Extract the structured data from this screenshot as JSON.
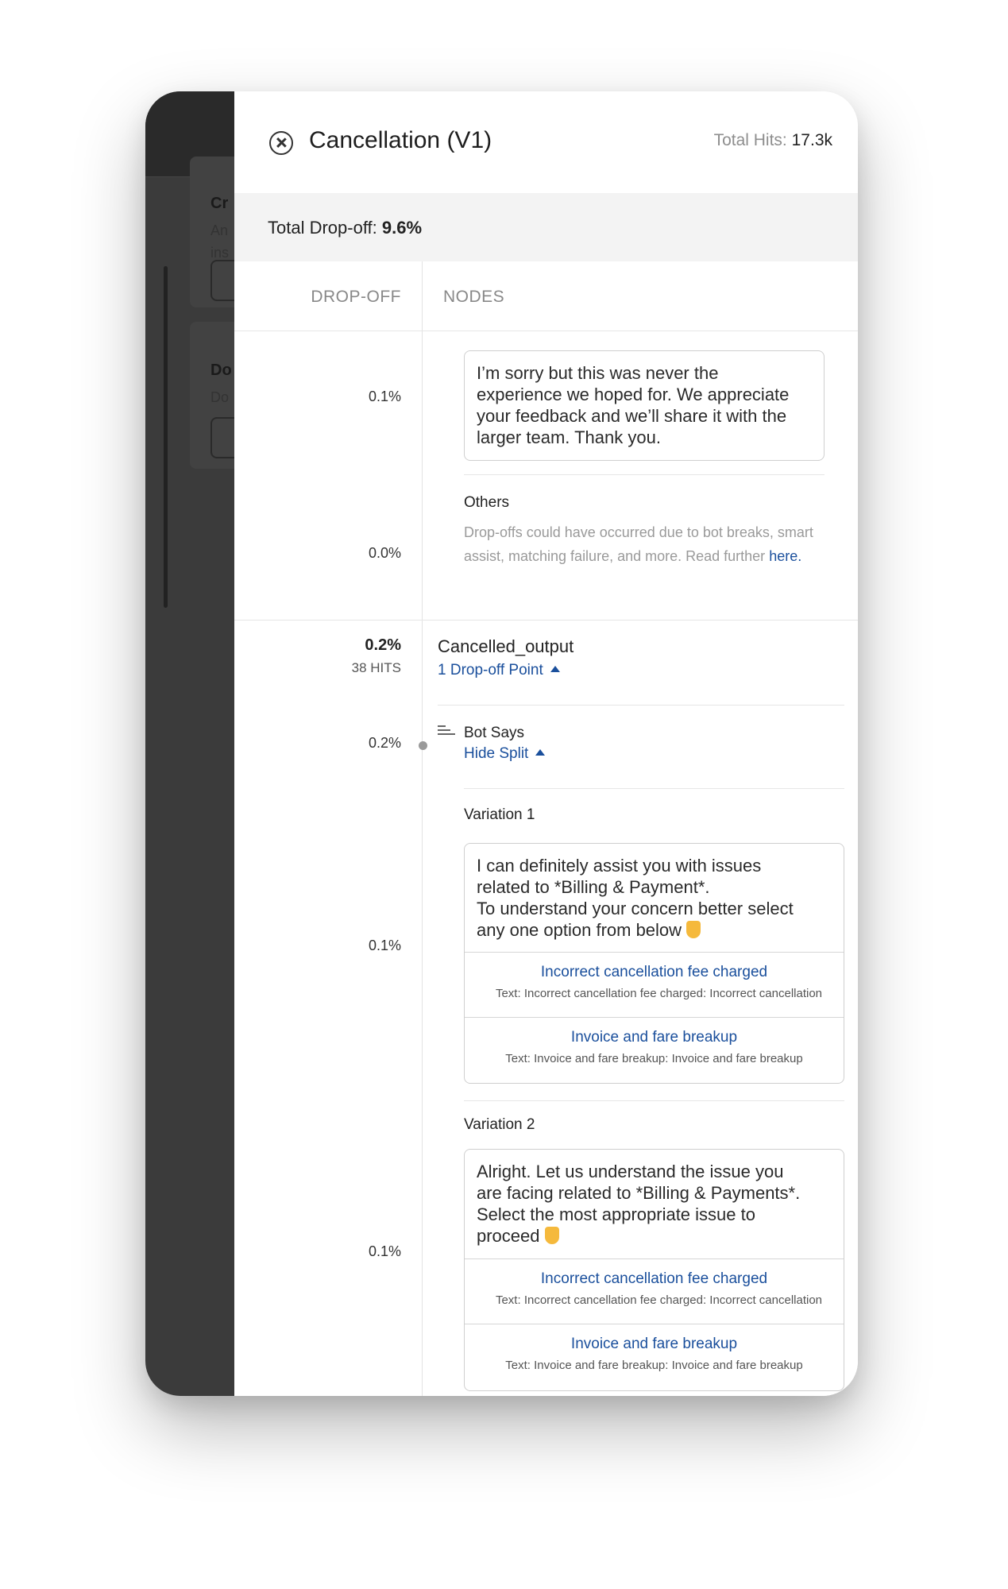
{
  "background_app": {
    "cards": [
      {
        "title": "Cr",
        "sub": [
          "An",
          "ins"
        ]
      },
      {
        "title": "Do",
        "sub": [
          "Do"
        ]
      }
    ]
  },
  "panel": {
    "title": "Cancellation (V1)",
    "total_hits_label": "Total Hits:",
    "total_hits_value": "17.3k",
    "total_dropoff_label": "Total Drop-off:",
    "total_dropoff_value": "9.6%",
    "columns": {
      "dropoff": "DROP-OFF",
      "nodes": "NODES"
    }
  },
  "section1": {
    "pct_message": "0.1%",
    "message": "I’m sorry but this was never the\nexperience we hoped for. We appreciate\nyour feedback and we’ll share it with the\nlarger team. Thank you.",
    "pct_others": "0.0%",
    "others_title": "Others",
    "others_text": "Drop-offs could have occurred due to bot breaks, smart assist, matching failure, and more. Read further",
    "others_link": "here."
  },
  "section2": {
    "pct": "0.2%",
    "hits": "38 HITS",
    "node_name": "Cancelled_output",
    "dropoff_points_link": "1 Drop-off Point",
    "bot_pct": "0.2%",
    "bot_says": "Bot Says",
    "hide_split": "Hide Split",
    "variations": [
      {
        "label": "Variation 1",
        "pct": "0.1%",
        "message": "I can definitely assist you with issues\nrelated to *Billing & Payment*.\nTo understand your concern better select\nany one option from below",
        "options": [
          {
            "label": "Incorrect cancellation fee charged",
            "sub": "Text: Incorrect cancellation fee charged: Incorrect cancellation"
          },
          {
            "label": "Invoice and fare breakup",
            "sub": "Text: Invoice and fare breakup: Invoice and fare breakup"
          }
        ]
      },
      {
        "label": "Variation 2",
        "pct": "0.1%",
        "message": "Alright. Let us understand the issue you\nare facing related to *Billing & Payments*.\nSelect the most appropriate issue to\nproceed",
        "options": [
          {
            "label": "Incorrect cancellation fee charged",
            "sub": "Text: Incorrect cancellation fee charged: Incorrect cancellation"
          },
          {
            "label": "Invoice and fare breakup",
            "sub": "Text: Invoice and fare breakup: Invoice and fare breakup"
          }
        ]
      }
    ]
  }
}
